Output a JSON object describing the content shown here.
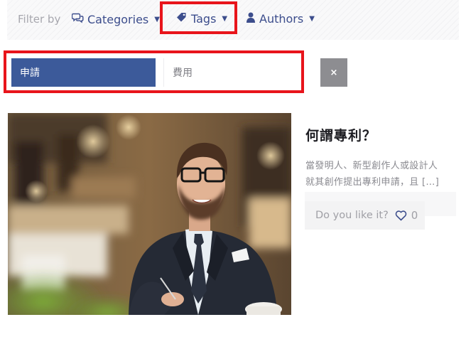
{
  "filters": {
    "label": "Filter by",
    "categories": "Categories",
    "tags": "Tags",
    "authors": "Authors",
    "caret": "▼"
  },
  "chips": {
    "active": "申請",
    "inactive": "費用",
    "clear": "×"
  },
  "post": {
    "title": "何謂專利？",
    "excerpt_lines": [
      "當發明人、新型創作人或設計人",
      "就其創作提出專利申請，且 […]"
    ],
    "like_label": "Do you like it?",
    "like_count": "0"
  },
  "colors": {
    "accent": "#3c5a9a",
    "link": "#3c4d8c",
    "highlight": "#e8141b",
    "clear_button": "#8d8d91"
  },
  "icons": {
    "categories": "chat-bubbles-icon",
    "tags": "tag-icon",
    "authors": "user-icon",
    "like": "heart-outline-icon"
  }
}
